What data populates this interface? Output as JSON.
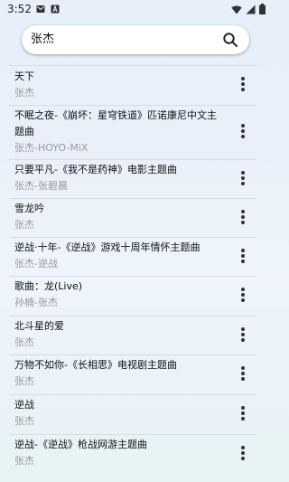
{
  "status_bar": {
    "time": "3:52"
  },
  "search": {
    "value": "张杰",
    "placeholder": ""
  },
  "songs": [
    {
      "title": "天下",
      "artist": "张杰"
    },
    {
      "title": "不眠之夜-《崩坏：星穹铁道》匹诺康尼中文主题曲",
      "artist": "张杰-HOYO-MiX"
    },
    {
      "title": "只要平凡-《我不是药神》电影主题曲",
      "artist": "张杰-张碧晨"
    },
    {
      "title": "雪龙吟",
      "artist": "张杰"
    },
    {
      "title": "逆战·十年-《逆战》游戏十周年情怀主题曲",
      "artist": "张杰-逆战"
    },
    {
      "title": "歌曲：龙(Live)",
      "artist": "孙楠-张杰"
    },
    {
      "title": "北斗星的爱",
      "artist": "张杰"
    },
    {
      "title": "万物不如你-《长相思》电视剧主题曲",
      "artist": "张杰"
    },
    {
      "title": "逆战",
      "artist": "张杰"
    },
    {
      "title": "逆战-《逆战》枪战网游主题曲",
      "artist": "张杰"
    }
  ],
  "icons": {
    "search": "search-icon",
    "more": "more-vertical-icon",
    "wifi": "wifi-icon",
    "signal": "signal-icon",
    "battery": "battery-icon",
    "notification_mail": "mail-notification-icon",
    "notification_app": "app-notification-icon"
  }
}
